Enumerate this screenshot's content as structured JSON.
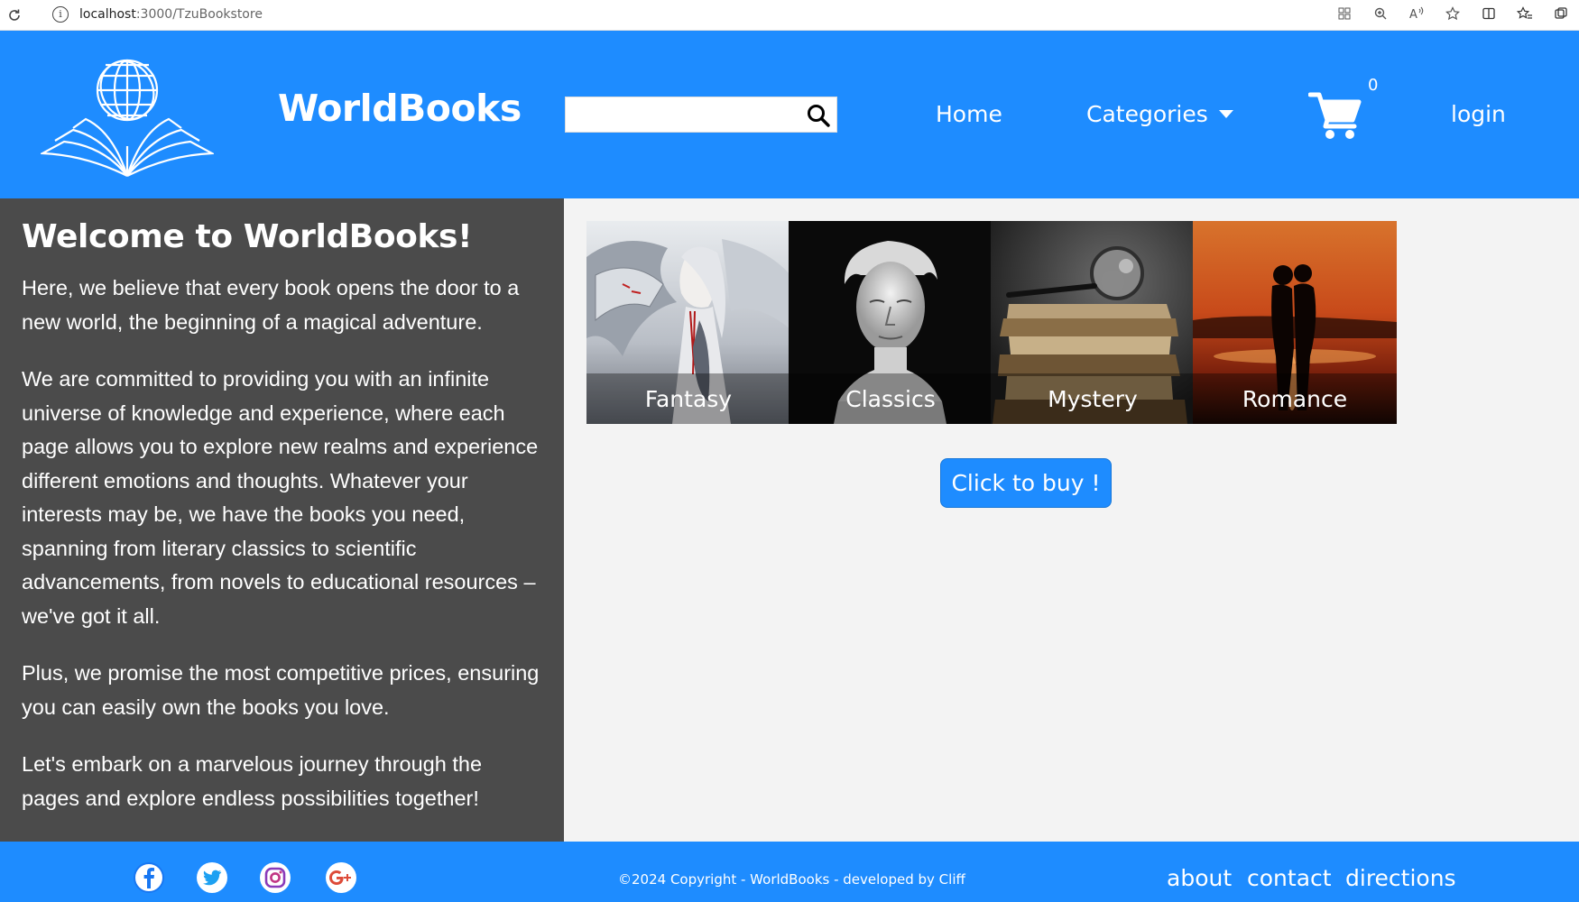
{
  "browser": {
    "url_host": "localhost",
    "url_path": ":3000/TzuBookstore"
  },
  "header": {
    "brand": "WorldBooks",
    "search_placeholder": "",
    "nav": {
      "home": "Home",
      "categories": "Categories",
      "login": "login"
    },
    "cart_count": "0"
  },
  "welcome": {
    "title": "Welcome to WorldBooks!",
    "paragraphs": [
      "Here, we believe that every book opens the door to a new world, the beginning of a magical adventure.",
      "We are committed to providing you with an infinite universe of knowledge and experience, where each page allows you to explore new realms and experience different emotions and thoughts. Whatever your interests may be, we have the books you need, spanning from literary classics to scientific advancements, from novels to educational resources – we've got it all.",
      "Plus, we promise the most competitive prices, ensuring you can easily own the books you love.",
      "Let's embark on a marvelous journey through the pages and explore endless possibilities together!"
    ]
  },
  "categories": [
    {
      "label": "Fantasy"
    },
    {
      "label": "Classics"
    },
    {
      "label": "Mystery"
    },
    {
      "label": "Romance"
    }
  ],
  "buy_button": "Click to buy !",
  "footer": {
    "copyright": "©2024 Copyright - WorldBooks - developed by Cliff",
    "links": {
      "about": "about",
      "contact": "contact",
      "directions": "directions"
    },
    "social_icons": [
      "facebook-icon",
      "twitter-icon",
      "instagram-icon",
      "google-plus-icon"
    ]
  },
  "colors": {
    "primary": "#1e8cff",
    "panel": "#4b4b4b",
    "background": "#f3f3f3"
  }
}
